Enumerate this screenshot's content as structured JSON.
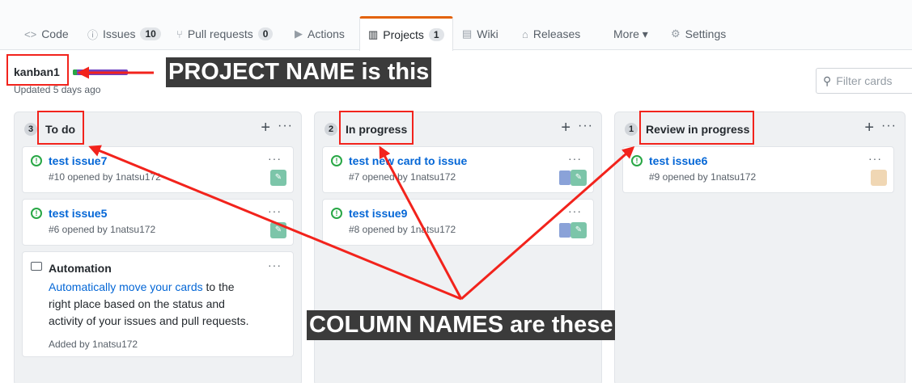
{
  "nav": {
    "tabs": [
      {
        "label": "Code",
        "icon": "code-icon"
      },
      {
        "label": "Issues",
        "count": "10",
        "icon": "issue-icon"
      },
      {
        "label": "Pull requests",
        "count": "0",
        "icon": "pull-request-icon"
      },
      {
        "label": "Actions",
        "icon": "play-icon"
      },
      {
        "label": "Projects",
        "count": "1",
        "icon": "project-icon",
        "selected": true
      },
      {
        "label": "Wiki",
        "icon": "book-icon"
      },
      {
        "label": "Releases",
        "icon": "tag-icon"
      },
      {
        "label": "More ▾",
        "icon": ""
      },
      {
        "label": "Settings",
        "icon": "gear-icon"
      }
    ]
  },
  "project": {
    "name": "kanban1",
    "updated": "Updated 5 days ago",
    "progress_done_fraction": 0.08
  },
  "filter": {
    "placeholder": "Filter cards"
  },
  "columns": [
    {
      "count": "3",
      "title": "To do",
      "cards": [
        {
          "title": "test issue7",
          "meta": "#10 opened by 1natsu172"
        },
        {
          "title": "test issue5",
          "meta": "#6 opened by 1natsu172"
        }
      ],
      "automation": {
        "title": "Automation",
        "link": "Automatically move your cards",
        "text": " to the right place based on the status and activity of your issues and pull requests.",
        "added": "Added by 1natsu172"
      }
    },
    {
      "count": "2",
      "title": "In progress",
      "cards": [
        {
          "title": "test new card to issue",
          "meta": "#7 opened by 1natsu172"
        },
        {
          "title": "test issue9",
          "meta": "#8 opened by 1natsu172"
        }
      ]
    },
    {
      "count": "1",
      "title": "Review in progress",
      "cards": [
        {
          "title": "test issue6",
          "meta": "#9 opened by 1natsu172"
        }
      ]
    }
  ],
  "annotations": {
    "project_label": "PROJECT NAME is this",
    "columns_label": "COLUMN NAMES are these",
    "color": "#f2231c"
  }
}
